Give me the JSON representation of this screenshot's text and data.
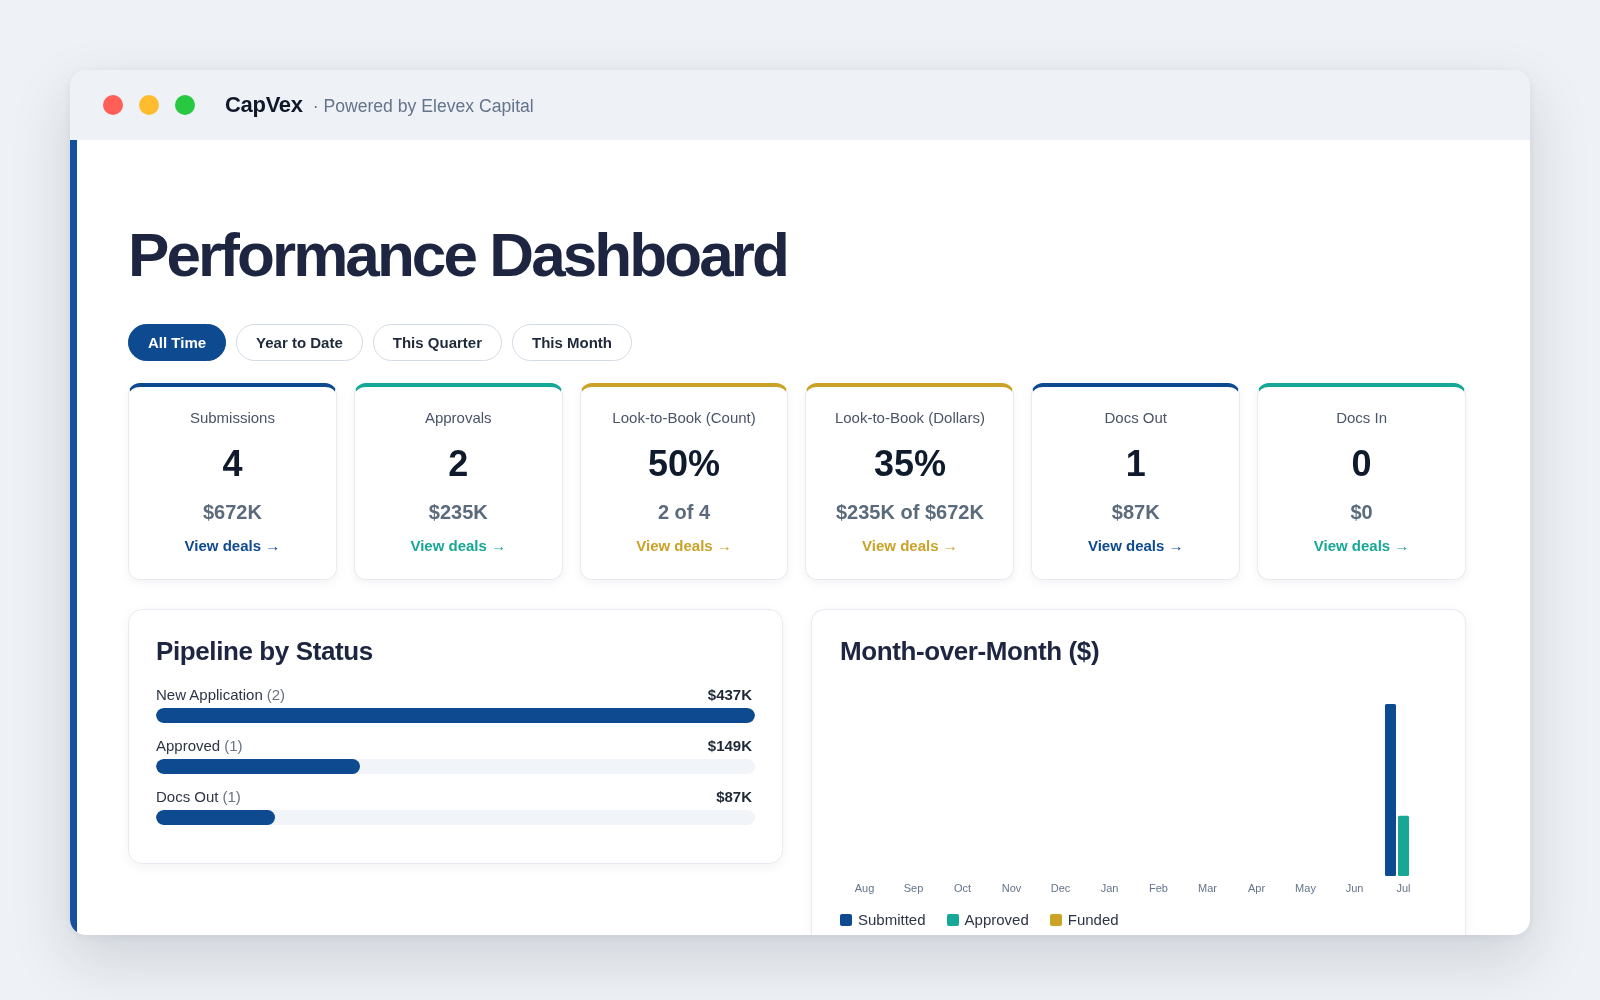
{
  "window": {
    "app_name": "CapVex",
    "tagline": "· Powered by Elevex Capital"
  },
  "page_title": "Performance Dashboard",
  "filters": [
    {
      "label": "All Time",
      "selected": true
    },
    {
      "label": "Year to Date",
      "selected": false
    },
    {
      "label": "This Quarter",
      "selected": false
    },
    {
      "label": "This Month",
      "selected": false
    }
  ],
  "cards": [
    {
      "label": "Submissions",
      "value": "4",
      "amount": "$672K",
      "link": "View deals →",
      "color": "#0e4a8f"
    },
    {
      "label": "Approvals",
      "value": "2",
      "amount": "$235K",
      "link": "View deals →",
      "color": "#17a796"
    },
    {
      "label": "Look-to-Book (Count)",
      "value": "50%",
      "amount": "2 of 4",
      "link": "View deals →",
      "color": "#c9a227"
    },
    {
      "label": "Look-to-Book (Dollars)",
      "value": "35%",
      "amount": "$235K of $672K",
      "link": "View deals →",
      "color": "#c9a227"
    },
    {
      "label": "Docs Out",
      "value": "1",
      "amount": "$87K",
      "link": "View deals →",
      "color": "#0e4a8f"
    },
    {
      "label": "Docs In",
      "value": "0",
      "amount": "$0",
      "link": "View deals →",
      "color": "#17a796"
    }
  ],
  "pipeline": {
    "title": "Pipeline by Status",
    "rows": [
      {
        "label": "New Application",
        "count": "(2)",
        "amount": "$437K",
        "level": 1.0
      },
      {
        "label": "Approved",
        "count": "(1)",
        "amount": "$149K",
        "level": 0.341
      },
      {
        "label": "Docs Out",
        "count": "(1)",
        "amount": "$87K",
        "level": 0.199
      }
    ]
  },
  "month_over_month": {
    "title": "Month-over-Month ($)",
    "months": [
      "Aug",
      "Sep",
      "Oct",
      "Nov",
      "Dec",
      "Jan",
      "Feb",
      "Mar",
      "Apr",
      "May",
      "Jun",
      "Jul"
    ],
    "legend": [
      {
        "name": "Submitted",
        "color": "#0e4a8f"
      },
      {
        "name": "Approved",
        "color": "#17a796"
      },
      {
        "name": "Funded",
        "color": "#c9a227"
      }
    ]
  }
}
